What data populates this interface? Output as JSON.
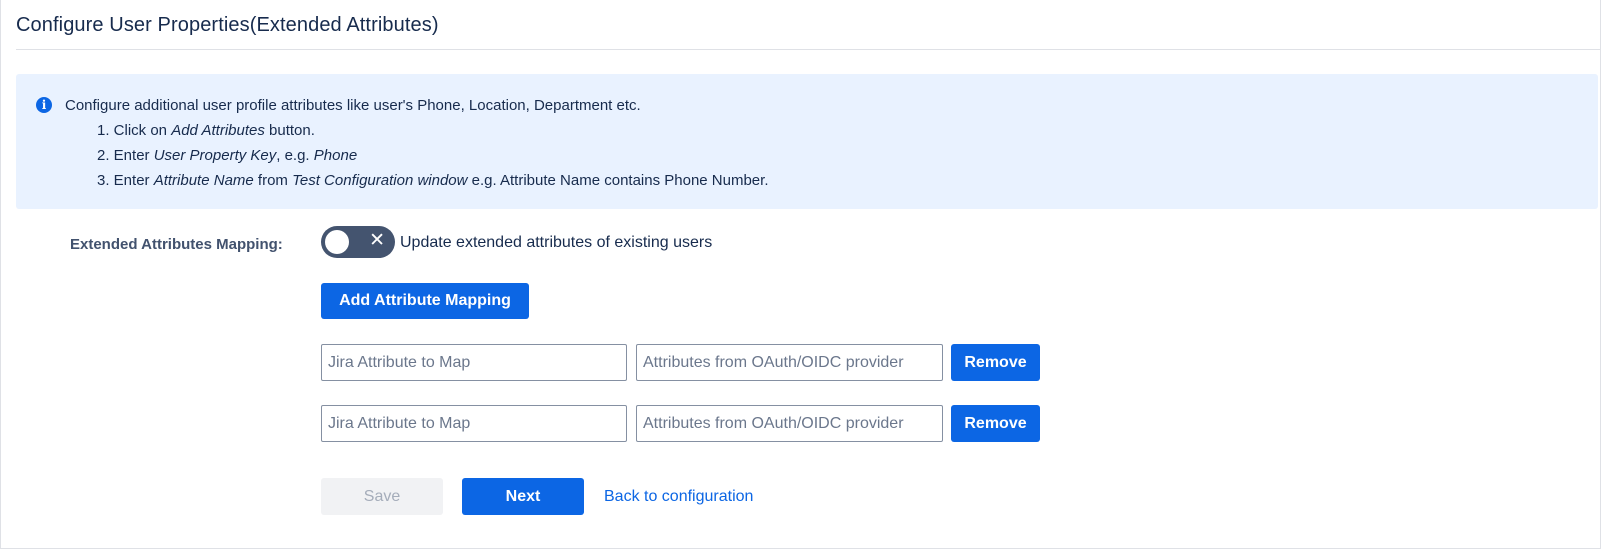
{
  "page": {
    "title": "Configure User Properties(Extended Attributes)"
  },
  "info": {
    "icon": "info-icon",
    "intro": "Configure additional user profile attributes like user's Phone, Location, Department etc.",
    "step1": {
      "prefix": "1. Click on ",
      "emphasis": "Add Attributes",
      "suffix": " button."
    },
    "step2": {
      "prefix": "2. Enter ",
      "emphasis1": "User Property Key",
      "middle": ", e.g. ",
      "emphasis2": "Phone"
    },
    "step3": {
      "prefix": "3. Enter ",
      "emphasis1": "Attribute Name",
      "middle": " from ",
      "emphasis2": "Test Configuration window",
      "suffix": " e.g. Attribute Name contains Phone Number."
    }
  },
  "mapping": {
    "label": "Extended Attributes Mapping:",
    "toggle_on": false,
    "toggle_icon": "close-icon",
    "toggle_text": "Update extended attributes of existing users",
    "add_button": "Add Attribute Mapping",
    "rows": [
      {
        "jira_value": "",
        "jira_placeholder": "Jira Attribute to Map",
        "oauth_value": "",
        "oauth_placeholder": "Attributes from OAuth/OIDC provider",
        "remove_label": "Remove"
      },
      {
        "jira_value": "",
        "jira_placeholder": "Jira Attribute to Map",
        "oauth_value": "",
        "oauth_placeholder": "Attributes from OAuth/OIDC provider",
        "remove_label": "Remove"
      }
    ]
  },
  "footer": {
    "save_label": "Save",
    "next_label": "Next",
    "back_link": "Back to configuration"
  },
  "colors": {
    "primary": "#0c66e4",
    "info_background": "#e9f2ff",
    "toggle_off": "#44546f",
    "disabled_background": "#f1f2f4"
  }
}
